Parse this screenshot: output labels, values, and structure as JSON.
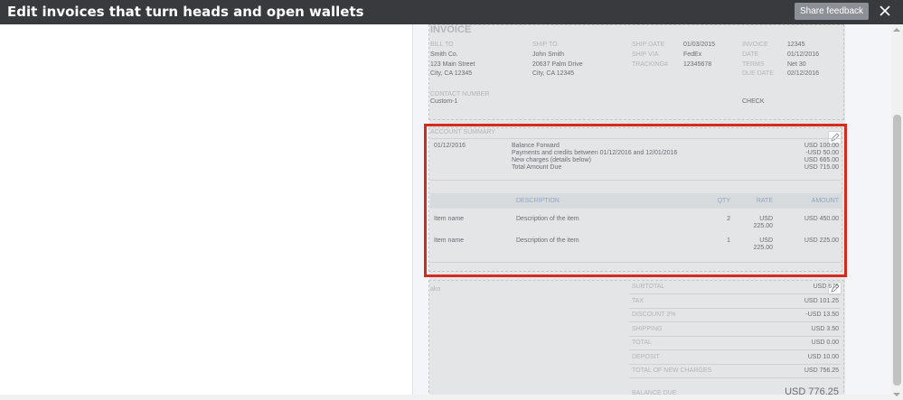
{
  "header": {
    "title": "Edit invoices that turn heads and open wallets",
    "share_feedback": "Share feedback"
  },
  "invoice": {
    "title": "INVOICE",
    "bill_to": {
      "label": "BILL TO",
      "line1": "Smith Co.",
      "line2": "123 Main Street",
      "line3": "City, CA 12345"
    },
    "ship_to": {
      "label": "SHIP TO",
      "line1": "John Smith",
      "line2": "20637 Palm Drive",
      "line3": "City, CA 12345"
    },
    "ship_info": {
      "date_label": "SHIP DATE",
      "date_value": "01/03/2015",
      "via_label": "SHIP VIA",
      "via_value": "FedEx",
      "tracking_label": "TRACKING#",
      "tracking_value": "12345678"
    },
    "invoice_info": {
      "invoice_label": "INVOICE",
      "invoice_value": "12345",
      "date_label": "DATE",
      "date_value": "01/12/2016",
      "terms_label": "TERMS",
      "terms_value": "Net 30",
      "due_label": "DUE DATE",
      "due_value": "02/12/2016"
    },
    "contact": {
      "label": "CONTACT NUMBER",
      "value": "Custom-1"
    },
    "check_label": "CHECK"
  },
  "account_summary": {
    "label": "ACCOUNT SUMMARY",
    "date": "01/12/2016",
    "lines": [
      {
        "text": "Balance Forward",
        "amount": "USD 100.00"
      },
      {
        "text": "Payments and credits between 01/12/2016 and 12/01/2016",
        "amount": "-USD 50.00"
      },
      {
        "text": "New charges (details below)",
        "amount": "USD 665.00"
      },
      {
        "text": "Total Amount Due",
        "amount": "USD 715.00"
      }
    ]
  },
  "items_table": {
    "headers": {
      "description": "DESCRIPTION",
      "qty": "QTY",
      "rate": "RATE",
      "amount": "AMOUNT"
    },
    "rows": [
      {
        "name": "Item name",
        "description": "Description of the item",
        "qty": "2",
        "rate_1": "USD",
        "rate_2": "225.00",
        "amount": "USD 450.00"
      },
      {
        "name": "Item name",
        "description": "Description of the item",
        "qty": "1",
        "rate_1": "USD",
        "rate_2": "225.00",
        "amount": "USD 225.00"
      }
    ]
  },
  "totals": {
    "note": "ako",
    "lines": [
      {
        "label": "SUBTOTAL",
        "amount": "USD 675"
      },
      {
        "label": "TAX",
        "amount": "USD 101.25"
      },
      {
        "label": "DISCOUNT 2%",
        "amount": "-USD 13.50"
      },
      {
        "label": "SHIPPING",
        "amount": "USD 3.50"
      },
      {
        "label": "TOTAL",
        "amount": "USD 0.00"
      },
      {
        "label": "DEPOSIT",
        "amount": "USD 10.00"
      },
      {
        "label": "TOTAL OF NEW CHARGES",
        "amount": "USD 756.25"
      }
    ],
    "balance_label": "BALANCE DUE",
    "balance_amount": "USD 776.25"
  },
  "colors": {
    "header_bg": "#393a3d",
    "highlight": "#d52b1e",
    "share_btn_bg": "#8d9096"
  },
  "icons": {
    "close": "close-icon",
    "edit": "pencil-icon"
  }
}
